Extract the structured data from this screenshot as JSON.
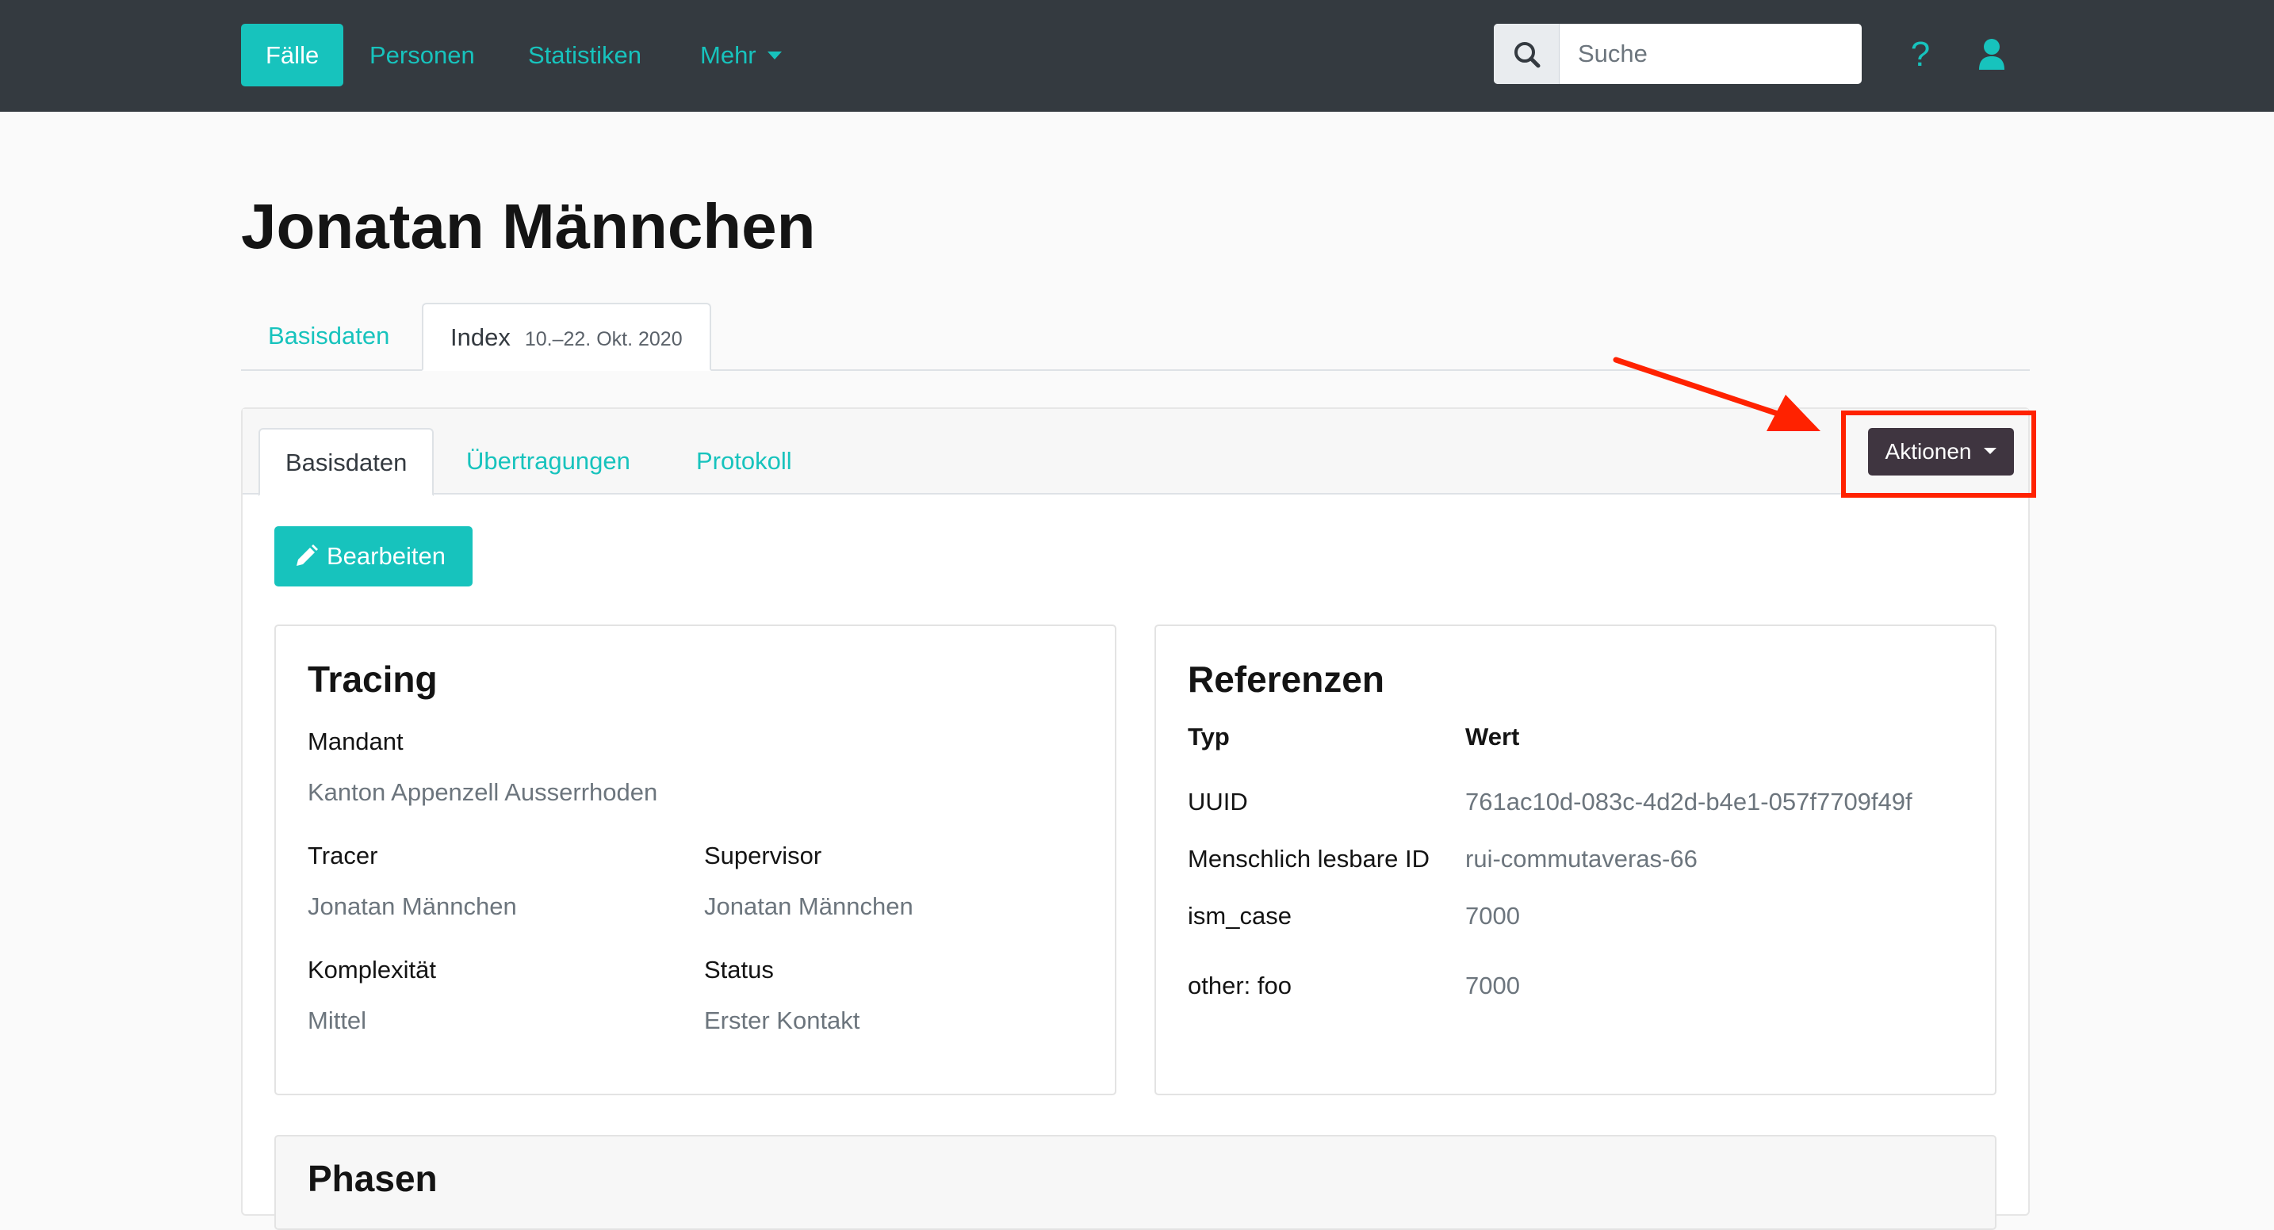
{
  "nav": {
    "items": [
      {
        "label": "Fälle",
        "active": true
      },
      {
        "label": "Personen"
      },
      {
        "label": "Statistiken"
      },
      {
        "label": "Mehr"
      }
    ],
    "search_placeholder": "Suche",
    "help_label": "?"
  },
  "page": {
    "title": "Jonatan Männchen"
  },
  "outer_tabs": {
    "basisdaten": "Basisdaten",
    "index": "Index",
    "index_dates": "10.–22. Okt. 2020"
  },
  "inner_tabs": {
    "basisdaten": "Basisdaten",
    "uebertragungen": "Übertragungen",
    "protokoll": "Protokoll"
  },
  "actions": {
    "aktionen": "Aktionen",
    "bearbeiten": "Bearbeiten"
  },
  "tracing": {
    "title": "Tracing",
    "mandant_label": "Mandant",
    "mandant_value": "Kanton Appenzell Ausserrhoden",
    "tracer_label": "Tracer",
    "tracer_value": "Jonatan Männchen",
    "supervisor_label": "Supervisor",
    "supervisor_value": "Jonatan Männchen",
    "komplexitaet_label": "Komplexität",
    "komplexitaet_value": "Mittel",
    "status_label": "Status",
    "status_value": "Erster Kontakt"
  },
  "referenzen": {
    "title": "Referenzen",
    "header_typ": "Typ",
    "header_wert": "Wert",
    "rows": [
      {
        "typ": "UUID",
        "wert": "761ac10d-083c-4d2d-b4e1-057f7709f49f"
      },
      {
        "typ": "Menschlich lesbare ID",
        "wert": "rui-commutaveras-66"
      },
      {
        "typ": "ism_case",
        "wert": "7000"
      },
      {
        "typ": "other: foo",
        "wert": "7000"
      }
    ]
  },
  "phasen": {
    "title": "Phasen"
  },
  "colors": {
    "accent": "#17c3bd",
    "navbar": "#343a40",
    "highlight": "#ff2200",
    "aktionen_bg": "#3f3540"
  }
}
